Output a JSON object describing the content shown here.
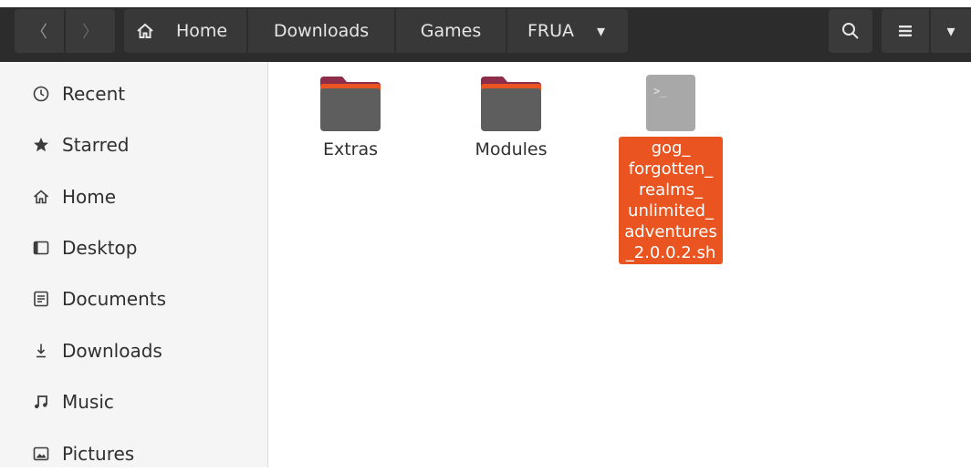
{
  "nav": {
    "back_glyph": "〈",
    "forward_glyph": "〉"
  },
  "breadcrumb": {
    "home_label": "Home",
    "items": [
      "Downloads",
      "Games",
      "FRUA"
    ],
    "dropdown_glyph": "▾"
  },
  "toolbar": {
    "search_icon": "search-icon",
    "view_icon": "list-view-icon",
    "menu_glyph": "▾"
  },
  "sidebar": {
    "items": [
      {
        "label": "Recent",
        "icon": "clock-icon"
      },
      {
        "label": "Starred",
        "icon": "star-icon"
      },
      {
        "label": "Home",
        "icon": "home-icon"
      },
      {
        "label": "Desktop",
        "icon": "desktop-icon"
      },
      {
        "label": "Documents",
        "icon": "documents-icon"
      },
      {
        "label": "Downloads",
        "icon": "download-icon"
      },
      {
        "label": "Music",
        "icon": "music-icon"
      },
      {
        "label": "Pictures",
        "icon": "pictures-icon"
      }
    ]
  },
  "files": [
    {
      "name": "Extras",
      "type": "folder"
    },
    {
      "name": "Modules",
      "type": "folder"
    },
    {
      "name": "gog_\nforgotten_\nrealms_\nunlimited_\nadventures\n_2.0.0.2.sh",
      "type": "script",
      "selected": true
    }
  ],
  "colors": {
    "accent": "#e95420",
    "headerbar": "#2c2c2c",
    "sidebar_bg": "#f5f5f5"
  }
}
